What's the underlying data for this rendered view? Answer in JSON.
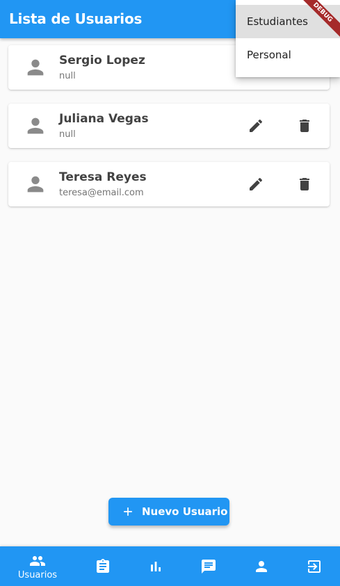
{
  "app_bar": {
    "title": "Lista de Usuarios"
  },
  "menu": {
    "items": [
      {
        "label": "Estudiantes",
        "selected": true
      },
      {
        "label": "Personal",
        "selected": false
      }
    ]
  },
  "debug_banner": {
    "label": "DEBUG"
  },
  "users": [
    {
      "name": "Sergio Lopez",
      "email": "null"
    },
    {
      "name": "Juliana Vegas",
      "email": "null"
    },
    {
      "name": "Teresa Reyes",
      "email": "teresa@email.com"
    }
  ],
  "fab": {
    "label": "Nuevo Usuario",
    "icon": "plus-icon"
  },
  "bottom_nav": {
    "items": [
      {
        "label": "Usuarios",
        "icon": "people-icon",
        "active": true
      },
      {
        "label": "",
        "icon": "clipboard-icon"
      },
      {
        "label": "",
        "icon": "bar-chart-icon"
      },
      {
        "label": "",
        "icon": "chat-icon"
      },
      {
        "label": "",
        "icon": "person-icon"
      },
      {
        "label": "",
        "icon": "logout-icon"
      }
    ]
  },
  "colors": {
    "primary": "#2196f3",
    "background": "#fafafa",
    "icon_gray": "#8a8a8a",
    "action_icon": "#424242",
    "debug_ribbon": "#a52a2a"
  }
}
